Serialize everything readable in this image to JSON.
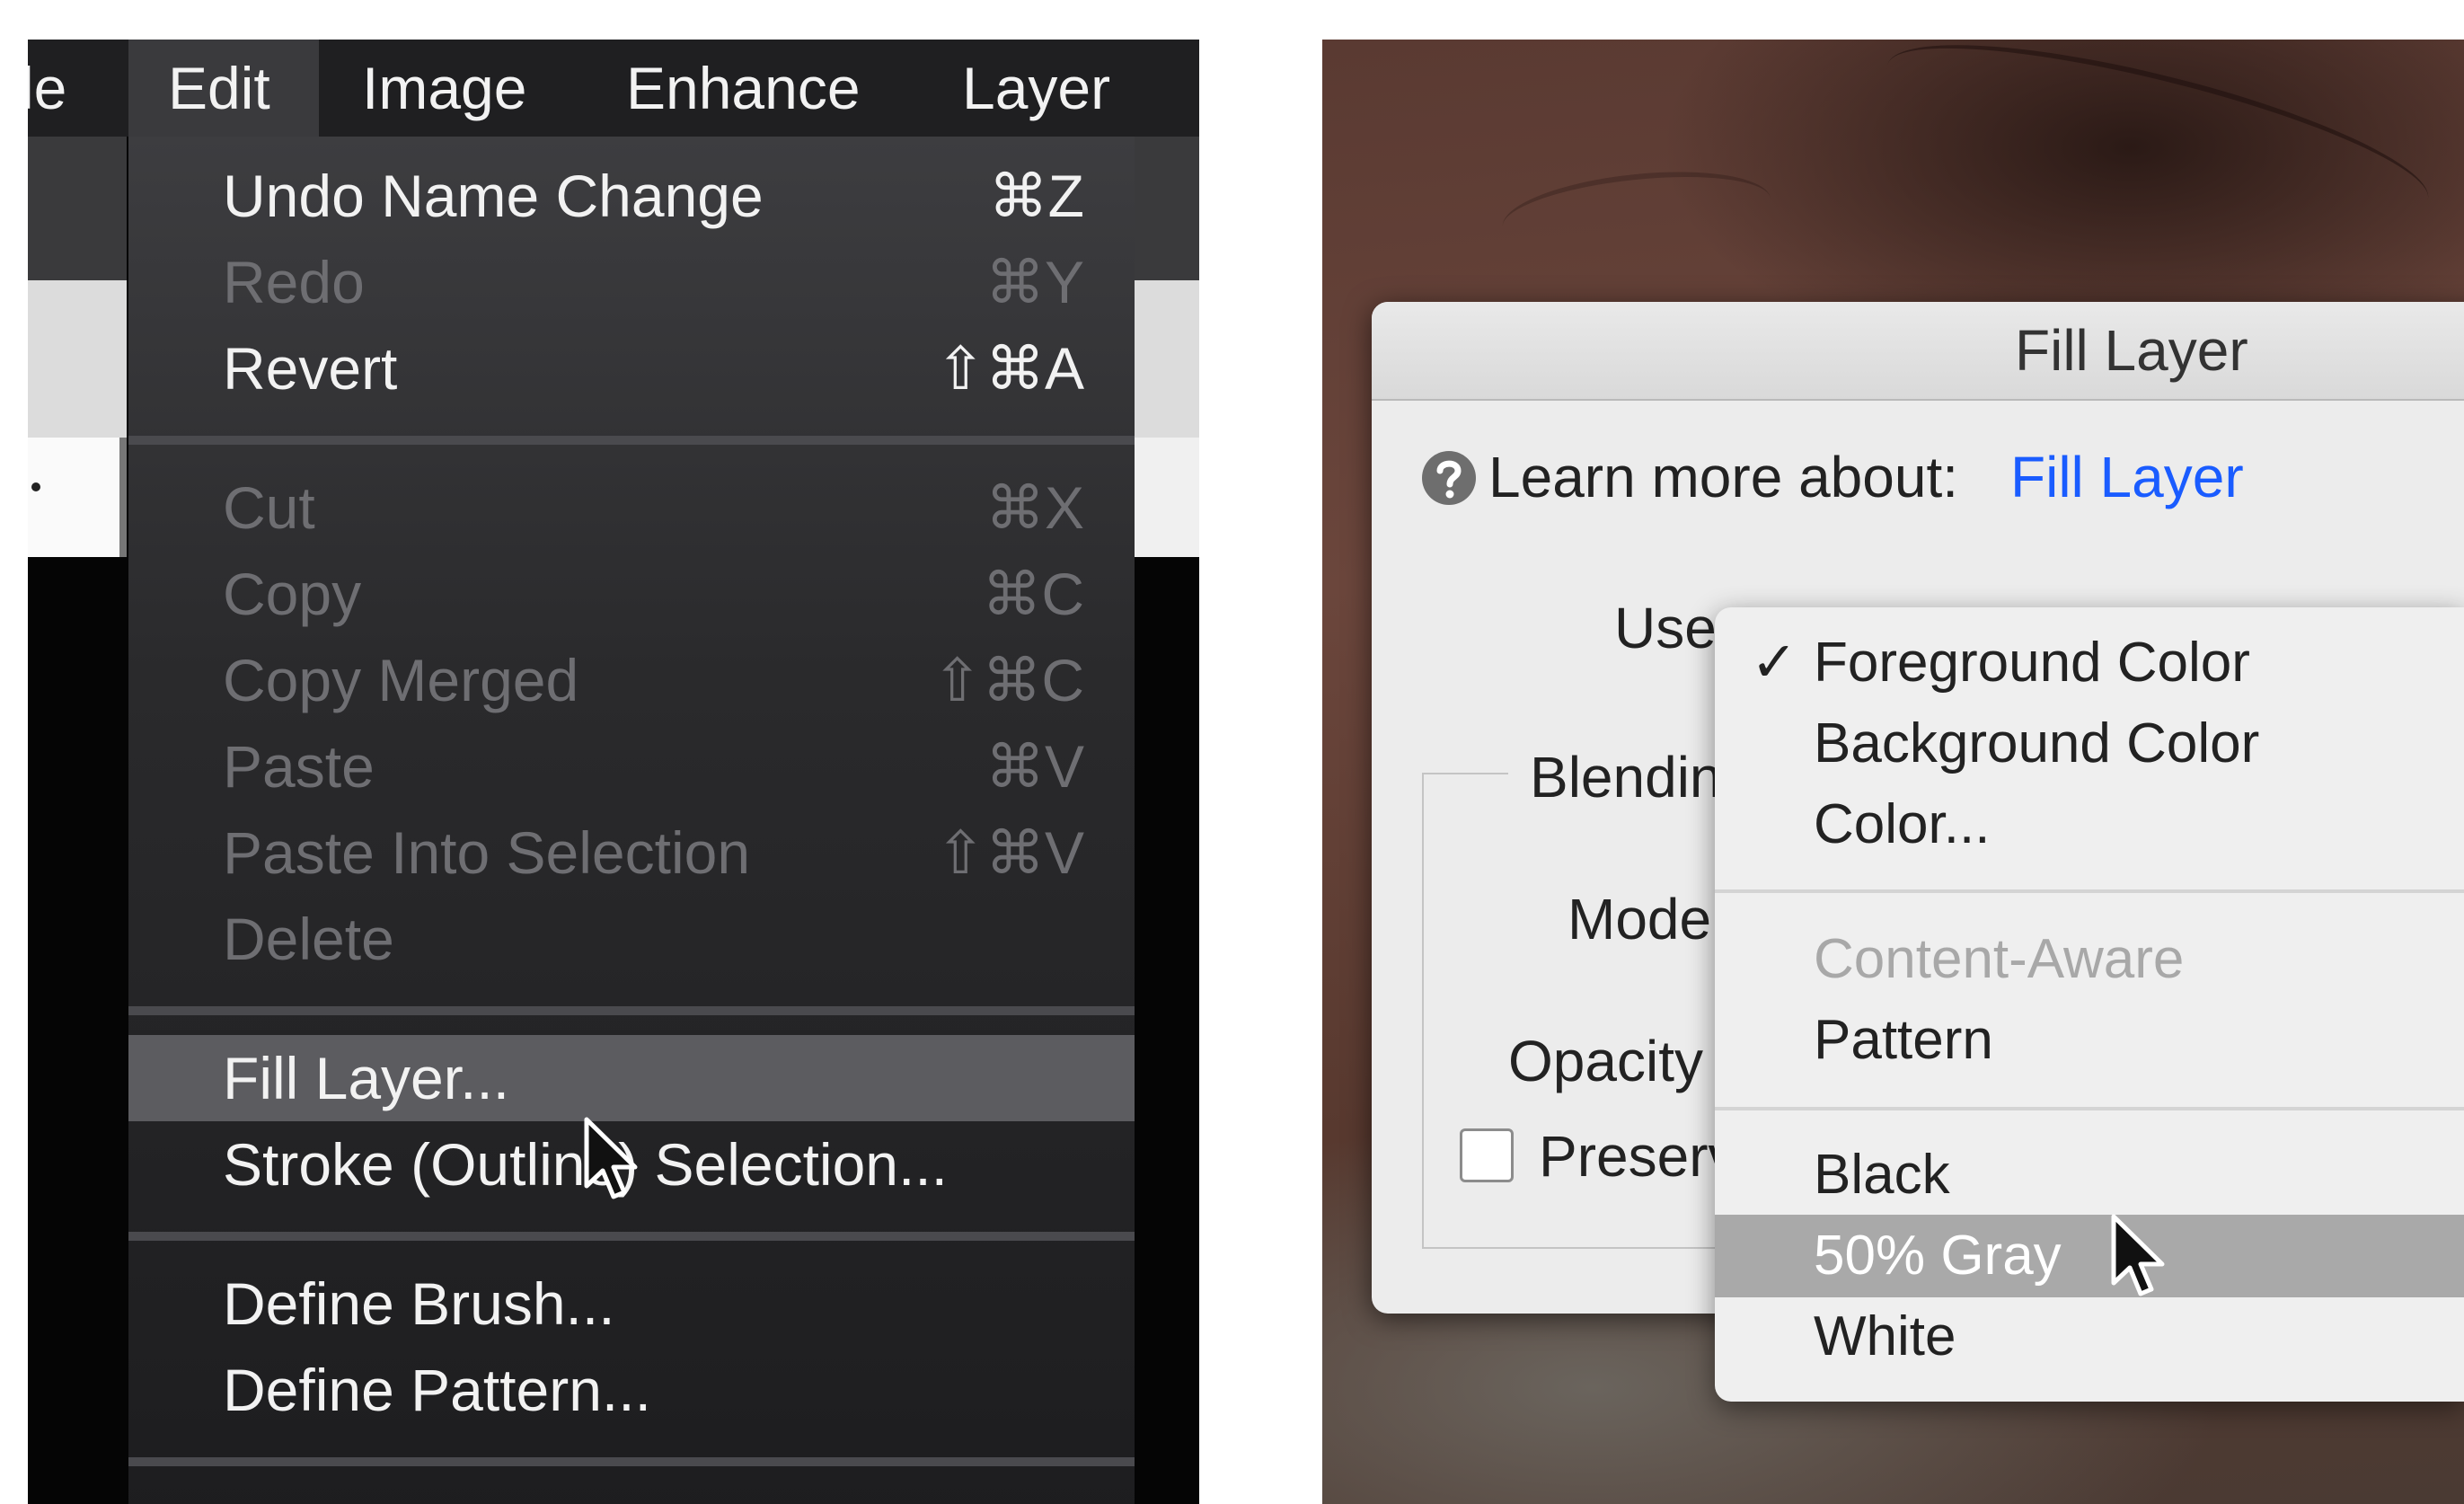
{
  "left": {
    "menubar": [
      {
        "label": "le",
        "active": false
      },
      {
        "label": "Edit",
        "active": true
      },
      {
        "label": "Image",
        "active": false
      },
      {
        "label": "Enhance",
        "active": false
      },
      {
        "label": "Layer",
        "active": false
      }
    ],
    "edit_menu": {
      "items": [
        {
          "label": "Undo Name Change",
          "shortcut": "⌘Z",
          "enabled": true
        },
        {
          "label": "Redo",
          "shortcut": "⌘Y",
          "enabled": false
        },
        {
          "label": "Revert",
          "shortcut": "⇧⌘A",
          "enabled": true
        },
        {
          "label": "Cut",
          "shortcut": "⌘X",
          "enabled": false
        },
        {
          "label": "Copy",
          "shortcut": "⌘C",
          "enabled": false
        },
        {
          "label": "Copy Merged",
          "shortcut": "⇧⌘C",
          "enabled": false
        },
        {
          "label": "Paste",
          "shortcut": "⌘V",
          "enabled": false
        },
        {
          "label": "Paste Into Selection",
          "shortcut": "⇧⌘V",
          "enabled": false
        },
        {
          "label": "Delete",
          "shortcut": "",
          "enabled": false
        },
        {
          "label": "Fill Layer...",
          "shortcut": "",
          "enabled": true,
          "highlighted": true
        },
        {
          "label": "Stroke (Outline) Selection...",
          "shortcut": "",
          "enabled": true
        },
        {
          "label": "Define Brush...",
          "shortcut": "",
          "enabled": true
        },
        {
          "label": "Define Pattern...",
          "shortcut": "",
          "enabled": true
        }
      ]
    }
  },
  "right": {
    "dialog": {
      "title": "Fill Layer",
      "learn_more_label": "Learn more about:",
      "learn_more_link": "Fill Layer",
      "use_label": "Use",
      "blending_label": "Blendin",
      "mode_label": "Mode",
      "opacity_label": "Opacity",
      "preserve_label": "Preserv",
      "preserve_checked": false
    },
    "use_dropdown": {
      "selected": "Foreground Color",
      "checkmark": "✓",
      "items": [
        {
          "label": "Foreground Color",
          "checked": true,
          "enabled": true
        },
        {
          "label": "Background Color",
          "enabled": true
        },
        {
          "label": "Color...",
          "enabled": true
        },
        {
          "label": "Content-Aware",
          "enabled": false
        },
        {
          "label": "Pattern",
          "enabled": true
        },
        {
          "label": "Black",
          "enabled": true
        },
        {
          "label": "50% Gray",
          "enabled": true,
          "highlighted": true
        },
        {
          "label": "White",
          "enabled": true
        }
      ]
    }
  },
  "colors": {
    "menu_background": "#2a2a2c",
    "menu_highlight": "#5c5c60",
    "link_blue": "#1a5cff",
    "dropdown_highlight": "#a9a9a9"
  }
}
